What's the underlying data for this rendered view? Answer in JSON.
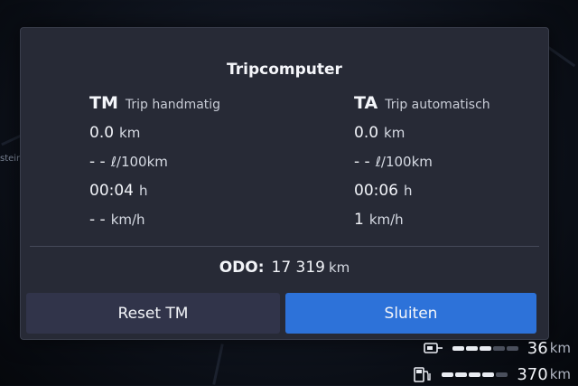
{
  "background": {
    "street_label": "steir"
  },
  "dialog": {
    "title": "Tripcomputer",
    "tm": {
      "code": "TM",
      "subtitle": "Trip handmatig",
      "distance_value": "0.0",
      "distance_unit": "km",
      "consumption_value": "- -",
      "consumption_unit": "ℓ/100km",
      "time_value": "00:04",
      "time_unit": "h",
      "speed_value": "- -",
      "speed_unit": "km/h"
    },
    "ta": {
      "code": "TA",
      "subtitle": "Trip automatisch",
      "distance_value": "0.0",
      "distance_unit": "km",
      "consumption_value": "- -",
      "consumption_unit": "ℓ/100km",
      "time_value": "00:06",
      "time_unit": "h",
      "speed_value": "1",
      "speed_unit": "km/h"
    },
    "odo": {
      "label": "ODO:",
      "value": "17 319",
      "unit": "km"
    },
    "buttons": {
      "reset": "Reset TM",
      "close": "Sluiten"
    }
  },
  "status": {
    "electric": {
      "icon": "battery-plug-icon",
      "value": "36",
      "unit": "km",
      "level_fraction": 0.6
    },
    "fuel": {
      "icon": "fuel-pump-icon",
      "value": "370",
      "unit": "km",
      "level_fraction": 0.8
    }
  },
  "colors": {
    "accent": "#2d72d9",
    "dialog_bg": "#272a36",
    "button_secondary": "#31344a"
  }
}
